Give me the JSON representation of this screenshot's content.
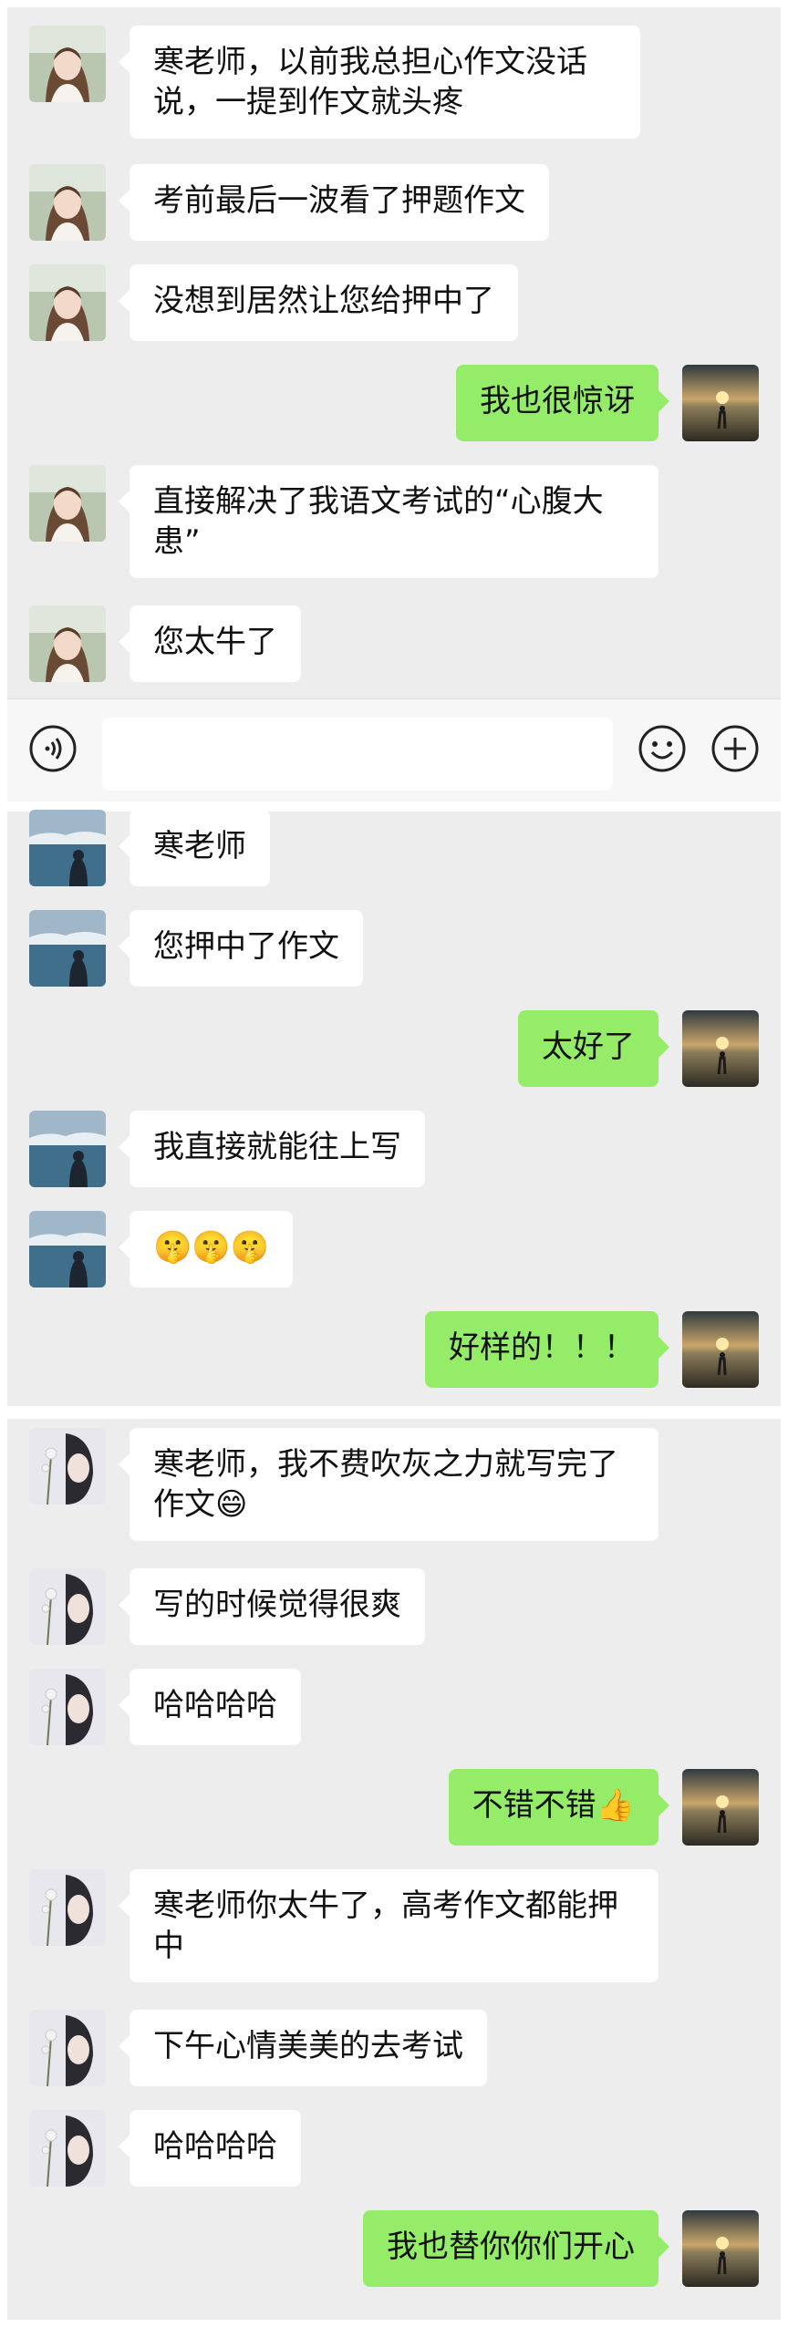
{
  "screenshot_1": {
    "messages": [
      {
        "side": "in",
        "text": "寒老师，以前我总担心作文没话说，一提到作文就头疼"
      },
      {
        "side": "in",
        "text": "考前最后一波看了押题作文"
      },
      {
        "side": "in",
        "text": "没想到居然让您给押中了"
      },
      {
        "side": "out",
        "text": "我也很惊讶"
      },
      {
        "side": "in",
        "text": "直接解决了我语文考试的“心腹大患”"
      },
      {
        "side": "in",
        "text": "您太牛了"
      }
    ],
    "input_bar": {
      "voice_icon": "voice-icon",
      "emoji_icon": "emoji-icon",
      "plus_icon": "plus-icon",
      "placeholder": ""
    }
  },
  "screenshot_2": {
    "messages": [
      {
        "side": "in",
        "text": "寒老师"
      },
      {
        "side": "in",
        "text": "您押中了作文"
      },
      {
        "side": "out",
        "text": "太好了"
      },
      {
        "side": "in",
        "text": "我直接就能往上写"
      },
      {
        "side": "in",
        "text": "🤫🤫🤫"
      },
      {
        "side": "out",
        "text": "好样的！！！"
      }
    ]
  },
  "screenshot_3": {
    "messages": [
      {
        "side": "in",
        "text": "寒老师，我不费吹灰之力就写完了作文😄"
      },
      {
        "side": "in",
        "text": "写的时候觉得很爽"
      },
      {
        "side": "in",
        "text": "哈哈哈哈"
      },
      {
        "side": "out",
        "text": "不错不错👍"
      },
      {
        "side": "in",
        "text": "寒老师你太牛了，高考作文都能押中"
      },
      {
        "side": "in",
        "text": "下午心情美美的去考试"
      },
      {
        "side": "in",
        "text": "哈哈哈哈"
      },
      {
        "side": "out",
        "text": "我也替你你们开心"
      }
    ]
  },
  "colors": {
    "outgoing_bubble": "#95ec69",
    "incoming_bubble": "#ffffff",
    "chat_background": "#ededed"
  }
}
